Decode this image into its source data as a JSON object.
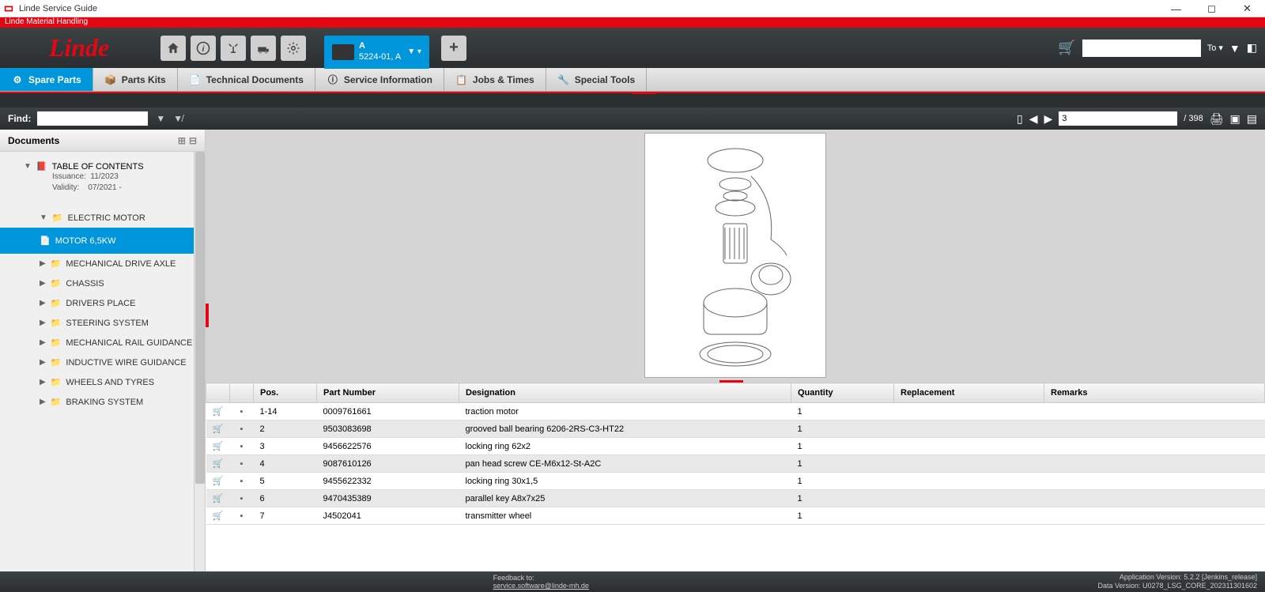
{
  "window": {
    "title": "Linde Service Guide",
    "brand_tag": "Linde Material Handling",
    "logo": "Linde"
  },
  "model_tab": {
    "line1": "A",
    "line2": "5224-01, A"
  },
  "header_right": {
    "to_label": "To ▾"
  },
  "nav_tabs": [
    {
      "label": "Spare Parts",
      "active": true
    },
    {
      "label": "Parts Kits"
    },
    {
      "label": "Technical Documents"
    },
    {
      "label": "Service Information"
    },
    {
      "label": "Jobs & Times"
    },
    {
      "label": "Special Tools"
    }
  ],
  "find": {
    "label": "Find:",
    "page_current": "3",
    "page_total": "/  398"
  },
  "sidebar": {
    "header": "Documents",
    "toc": {
      "title": "TABLE OF CONTENTS",
      "issuance_label": "Issuance:",
      "issuance": "11/2023",
      "validity_label": "Validity:",
      "validity": "07/2021 -"
    },
    "items": [
      {
        "label": "ELECTRIC MOTOR",
        "expanded": true,
        "children": [
          {
            "label": "MOTOR 6,5KW",
            "selected": true
          }
        ]
      },
      {
        "label": "MECHANICAL DRIVE AXLE"
      },
      {
        "label": "CHASSIS"
      },
      {
        "label": "DRIVERS PLACE"
      },
      {
        "label": "STEERING SYSTEM"
      },
      {
        "label": "MECHANICAL RAIL GUIDANCE"
      },
      {
        "label": "INDUCTIVE WIRE GUIDANCE"
      },
      {
        "label": "WHEELS AND TYRES"
      },
      {
        "label": "BRAKING SYSTEM"
      }
    ]
  },
  "table": {
    "headers": {
      "pos": "Pos.",
      "part_number": "Part Number",
      "designation": "Designation",
      "quantity": "Quantity",
      "replacement": "Replacement",
      "remarks": "Remarks"
    },
    "rows": [
      {
        "pos": "1-14",
        "pn": "0009761661",
        "desig": "traction motor",
        "qty": "1"
      },
      {
        "pos": "2",
        "pn": "9503083698",
        "desig": "grooved ball bearing 6206-2RS-C3-HT22",
        "qty": "1"
      },
      {
        "pos": "3",
        "pn": "9456622576",
        "desig": "locking ring 62x2",
        "qty": "1"
      },
      {
        "pos": "4",
        "pn": "9087610126",
        "desig": "pan head screw CE-M6x12-St-A2C",
        "qty": "1"
      },
      {
        "pos": "5",
        "pn": "9455622332",
        "desig": "locking ring 30x1,5",
        "qty": "1"
      },
      {
        "pos": "6",
        "pn": "9470435389",
        "desig": "parallel key A8x7x25",
        "qty": "1"
      },
      {
        "pos": "7",
        "pn": "J4502041",
        "desig": "transmitter wheel",
        "qty": "1"
      }
    ]
  },
  "footer": {
    "feedback_label": "Feedback to:",
    "feedback_email": "service.software@linde-mh.de",
    "app_version": "Application Version: 5.2.2 [Jenkins_release]",
    "data_version": "Data Version: U0278_LSG_CORE_202311301602"
  }
}
